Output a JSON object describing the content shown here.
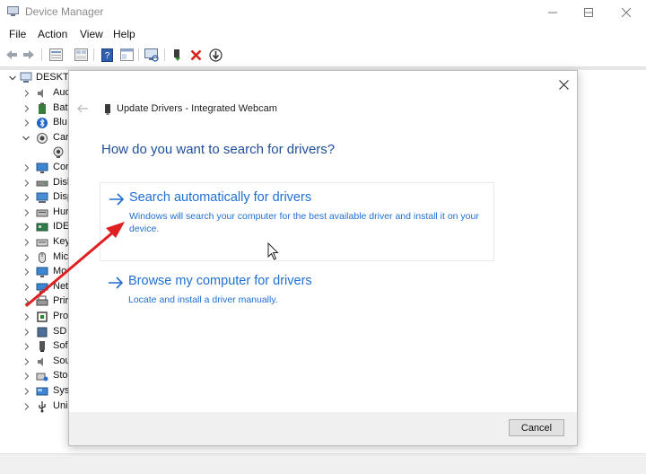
{
  "window": {
    "title": "Device Manager",
    "icons": {
      "app": "device-manager-icon",
      "minimize": "minimize-icon",
      "maximize": "maximize-icon",
      "close": "close-icon"
    }
  },
  "menu": [
    "File",
    "Action",
    "View",
    "Help"
  ],
  "toolbar": {
    "icons": [
      "back-arrow-icon",
      "forward-arrow-icon",
      "properties-grid-icon",
      "show-hidden-icon",
      "help-book-icon",
      "console-icon",
      "scan-hardware-monitor-icon",
      "enable-device-icon",
      "uninstall-x-icon",
      "update-driver-icon"
    ],
    "colors": {
      "uninstall": "#d9221b",
      "enable": "#2a8a2a"
    }
  },
  "tree": {
    "root": "DESKTO",
    "items": [
      {
        "label": "Aud",
        "icon": "speaker-icon",
        "expanded": false
      },
      {
        "label": "Bat",
        "icon": "battery-icon",
        "expanded": false
      },
      {
        "label": "Blu",
        "icon": "bluetooth-icon",
        "expanded": false
      },
      {
        "label": "Car",
        "icon": "camera-icon",
        "expanded": true
      },
      {
        "label": "",
        "icon": "webcam-icon",
        "child": true
      },
      {
        "label": "Cor",
        "icon": "monitor-icon",
        "expanded": false
      },
      {
        "label": "Disl",
        "icon": "disk-drive-icon",
        "expanded": false
      },
      {
        "label": "Disp",
        "icon": "display-adapter-icon",
        "expanded": false
      },
      {
        "label": "Hur",
        "icon": "keyboard-hid-icon",
        "expanded": false
      },
      {
        "label": "IDE",
        "icon": "ide-controller-icon",
        "expanded": false
      },
      {
        "label": "Key",
        "icon": "keyboard-icon",
        "expanded": false
      },
      {
        "label": "Mic",
        "icon": "mouse-icon",
        "expanded": false
      },
      {
        "label": "Mo",
        "icon": "monitor-icon",
        "expanded": false
      },
      {
        "label": "Net",
        "icon": "network-adapter-icon",
        "expanded": false
      },
      {
        "label": "Prir",
        "icon": "printer-icon",
        "expanded": false
      },
      {
        "label": "Pro",
        "icon": "processor-icon",
        "expanded": false
      },
      {
        "label": "SD",
        "icon": "sd-host-icon",
        "expanded": false
      },
      {
        "label": "Sof",
        "icon": "software-device-icon",
        "expanded": false
      },
      {
        "label": "Sou",
        "icon": "speaker-icon",
        "expanded": false
      },
      {
        "label": "Sto",
        "icon": "storage-icon",
        "expanded": false
      },
      {
        "label": "Sys",
        "icon": "system-devices-icon",
        "expanded": false
      },
      {
        "label": "Uni",
        "icon": "usb-icon",
        "expanded": false
      }
    ]
  },
  "dialog": {
    "title": "Update Drivers - Integrated Webcam",
    "heading": "How do you want to search for drivers?",
    "options": [
      {
        "title": "Search automatically for drivers",
        "description": "Windows will search your computer for the best available driver and install it on your device."
      },
      {
        "title": "Browse my computer for drivers",
        "description": "Locate and install a driver manually."
      }
    ],
    "cancel_label": "Cancel",
    "colors": {
      "link": "#1f6fd1",
      "heading": "#1f4e9c",
      "footer": "#f0f0f0"
    }
  },
  "annotation": {
    "type": "red-arrow",
    "color": "#e02020",
    "points_to": "Search automatically for drivers"
  }
}
